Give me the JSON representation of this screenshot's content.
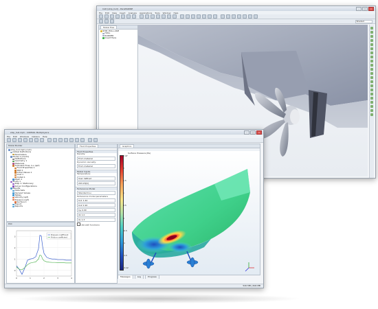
{
  "back_window": {
    "title": "CAD [ship_hull] - ParaMARINE",
    "menu": [
      "File",
      "Edit",
      "View",
      "Insert",
      "Analysis",
      "Applications",
      "Tools",
      "Window",
      "Help"
    ],
    "zoom_value": "Shaded",
    "model_tree_tab": "Model Tree",
    "tree_items": [
      "SHIP_HULL.ASM",
      "HULL",
      "RUDDER",
      "Insert Here"
    ],
    "toolbar_count": 28
  },
  "front_window": {
    "title": "ship_hull.mph - COMSOL Multiphysics",
    "menu": [
      "File",
      "Edit",
      "Windows",
      "Options",
      "Help"
    ],
    "model_builder": {
      "header": "Model Builder",
      "items": [
        "ship_hull.mph (root)",
        "Global Definitions",
        "Parameters",
        "Model 1 (mod1)",
        "Definitions",
        "Geometry 1",
        "Materials",
        "Turbulent Flow, k-ε (spf)",
        "Fluid Properties 1",
        "Wall 1",
        "Initial Values 1",
        "Inlet 1",
        "Outlet 1",
        "Mesh 1",
        "Study 1",
        "Step 1: Stationary",
        "Solver Configurations",
        "Results",
        "Data Sets",
        "Derived Values",
        "Tables",
        "Velocity (spf)",
        "Pressure (spf)",
        "Surface 1",
        "Export",
        "Reports"
      ]
    },
    "settings": {
      "tab": "Fluid Properties",
      "section1": "Fluid Properties",
      "field1_label": "Density:",
      "field1_value": "From material",
      "field2_label": "Dynamic viscosity:",
      "field2_value": "From material",
      "section2": "Model Inputs",
      "field3_label": "Temperature:",
      "field3_value": "User defined",
      "field4_value": "293.15[K]",
      "section3": "Turbulence Model",
      "field5_value": "Standard k-ε",
      "lbl_a": "Turbulence model parameters",
      "lbl_b": "Cε1 1.44",
      "lbl_c": "Cε2 1.92",
      "lbl_d": "Cμ 0.09",
      "lbl_e": "σk 1.0",
      "lbl_f": "σε 1.3",
      "checkbox": "Use wall functions"
    },
    "graphics_tab": "Graphics",
    "graphics_title": "Surface: Pressure (Pa)",
    "colorbar_ticks": [
      "2.47",
      "2",
      "1.5",
      "1",
      "0.5",
      "0",
      "-0.5",
      "-1",
      "-1.5",
      "-2.12"
    ],
    "bottom_tabs": [
      "Messages",
      "Log",
      "Progress"
    ],
    "plot": {
      "header": "Plot",
      "legend": [
        "Pressure coefficient",
        "Friction coefficient"
      ]
    },
    "status": "520 MB | 604 MB"
  },
  "chart_data": {
    "type": "line",
    "title": "",
    "xlabel": "",
    "ylabel": "",
    "xlim": [
      0,
      4
    ],
    "ylim": [
      -0.5,
      3.5
    ],
    "x": [
      0,
      0.2,
      0.4,
      0.6,
      0.8,
      1.0,
      1.2,
      1.4,
      1.6,
      1.7,
      1.8,
      1.9,
      2.0,
      2.2,
      2.4,
      2.6,
      2.8,
      3.0,
      3.2,
      3.4,
      3.6,
      3.8,
      4.0
    ],
    "series": [
      {
        "name": "Pressure coefficient",
        "color": "#3a5fcd",
        "values": [
          0.4,
          0.1,
          -0.35,
          0.2,
          0.9,
          1.0,
          1.05,
          1.2,
          1.9,
          3.1,
          3.05,
          2.1,
          1.5,
          1.15,
          1.05,
          1.0,
          1.0,
          0.95,
          0.95,
          0.95,
          0.9,
          0.9,
          0.9
        ]
      },
      {
        "name": "Friction coefficient",
        "color": "#5cb85c",
        "values": [
          0.3,
          0.1,
          0.05,
          0.25,
          0.5,
          0.65,
          0.7,
          0.75,
          1.0,
          1.35,
          1.3,
          1.0,
          0.85,
          0.75,
          0.72,
          0.7,
          0.7,
          0.68,
          0.68,
          0.68,
          0.66,
          0.66,
          0.66
        ]
      }
    ]
  }
}
